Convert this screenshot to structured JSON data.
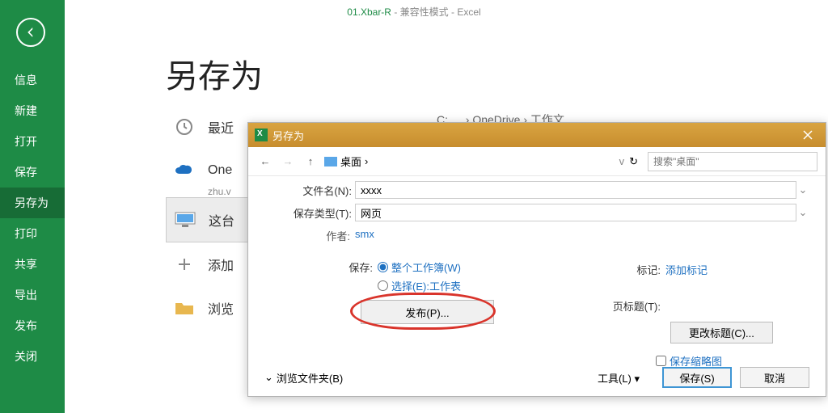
{
  "title_bar": {
    "doc": "01.Xbar-R",
    "mode": "兼容性模式",
    "app": "Excel"
  },
  "sidebar": {
    "items": [
      "信息",
      "新建",
      "打开",
      "保存",
      "另存为",
      "打印",
      "共享",
      "导出",
      "发布",
      "关闭"
    ],
    "selected_index": 4
  },
  "backstage": {
    "title": "另存为",
    "rows": [
      {
        "label": "最近",
        "icon": "clock"
      },
      {
        "label": "One",
        "sub": "zhu.v",
        "icon": "onedrive"
      },
      {
        "label": "这台",
        "icon": "pc",
        "selected": true
      },
      {
        "label": "添加",
        "icon": "plus"
      },
      {
        "label": "浏览",
        "icon": "folder"
      }
    ],
    "breadcrumb_prefix": "C:",
    "breadcrumb_dots": "…",
    "breadcrumb_tail": "› OneDrive › 工作文"
  },
  "dialog": {
    "title": "另存为",
    "nav": {
      "location": "桌面",
      "search_placeholder": "搜索\"桌面\""
    },
    "filename_label": "文件名(N):",
    "filename_value": "xxxx",
    "type_label": "保存类型(T):",
    "type_value": "网页",
    "author_label": "作者:",
    "author_value": "smx",
    "tag_label": "标记:",
    "tag_value": "添加标记",
    "save_label": "保存:",
    "radio_all": "整个工作簿(W)",
    "radio_sel": "选择(E):工作表",
    "publish_btn": "发布(P)...",
    "page_title_label": "页标题(T):",
    "change_title_btn": "更改标题(C)...",
    "thumb_label": "保存缩略图",
    "browse_folder": "浏览文件夹(B)",
    "tools": "工具(L)",
    "save_btn": "保存(S)",
    "cancel_btn": "取消"
  }
}
